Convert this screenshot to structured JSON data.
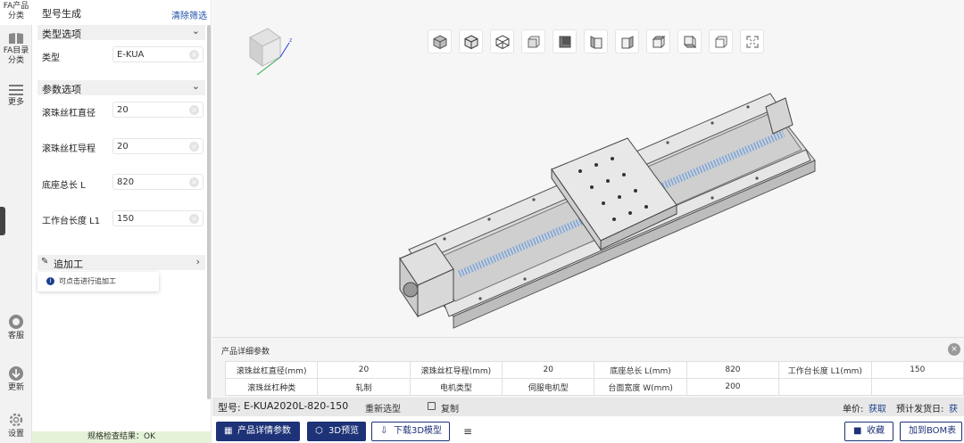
{
  "rail": {
    "items": [
      {
        "label_1": "FA产品",
        "label_2": "分类"
      },
      {
        "label_1": "FA目录",
        "label_2": "分类"
      },
      {
        "label_1": "更多",
        "label_2": ""
      },
      {
        "label_1": "客服",
        "label_2": ""
      },
      {
        "label_1": "更新",
        "label_2": ""
      },
      {
        "label_1": "设置",
        "label_2": ""
      }
    ]
  },
  "panel": {
    "title": "型号生成",
    "clear": "清除筛选",
    "type_section": "类型选项",
    "type_label": "类型",
    "type_value": "E-KUA",
    "param_section": "参数选项",
    "params": [
      {
        "label": "滚珠丝杠直径",
        "value": "20"
      },
      {
        "label": "滚珠丝杠导程",
        "value": "20"
      },
      {
        "label": "底座总长 L",
        "value": "820"
      },
      {
        "label": "工作台长度 L1",
        "value": "150"
      }
    ],
    "addon": "追加工",
    "addon_hint": "可点击进行追加工",
    "check_result": "规格检查结果：OK"
  },
  "details": {
    "title": "产品详细参数",
    "rows": [
      [
        "滚珠丝杠直径(mm)",
        "20",
        "滚珠丝杠导程(mm)",
        "20",
        "底座总长 L(mm)",
        "820",
        "工作台长度 L1(mm)",
        "150"
      ],
      [
        "滚珠丝杠种类",
        "轧制",
        "电机类型",
        "伺服电机型",
        "台面宽度 W(mm)",
        "200",
        "",
        ""
      ]
    ]
  },
  "modelbar": {
    "label": "型号:",
    "value": "E-KUA2020L-820-150",
    "reselect": "重新选型",
    "copy": "复制",
    "price_label": "单价:",
    "price_value": "获取",
    "ship_label": "预计发货日:",
    "ship_value": "获取"
  },
  "actions": {
    "details_btn": "产品详情参数",
    "preview_btn": "3D预览",
    "download_btn": "下载3D模型",
    "favorite_btn": "收藏",
    "bom_btn": "加到BOM表"
  },
  "viewcube": {
    "axis_z": "z"
  },
  "colors": {
    "brand": "#1d3277",
    "link": "#1d4fa8",
    "ok_bg": "#e4f3d8"
  }
}
